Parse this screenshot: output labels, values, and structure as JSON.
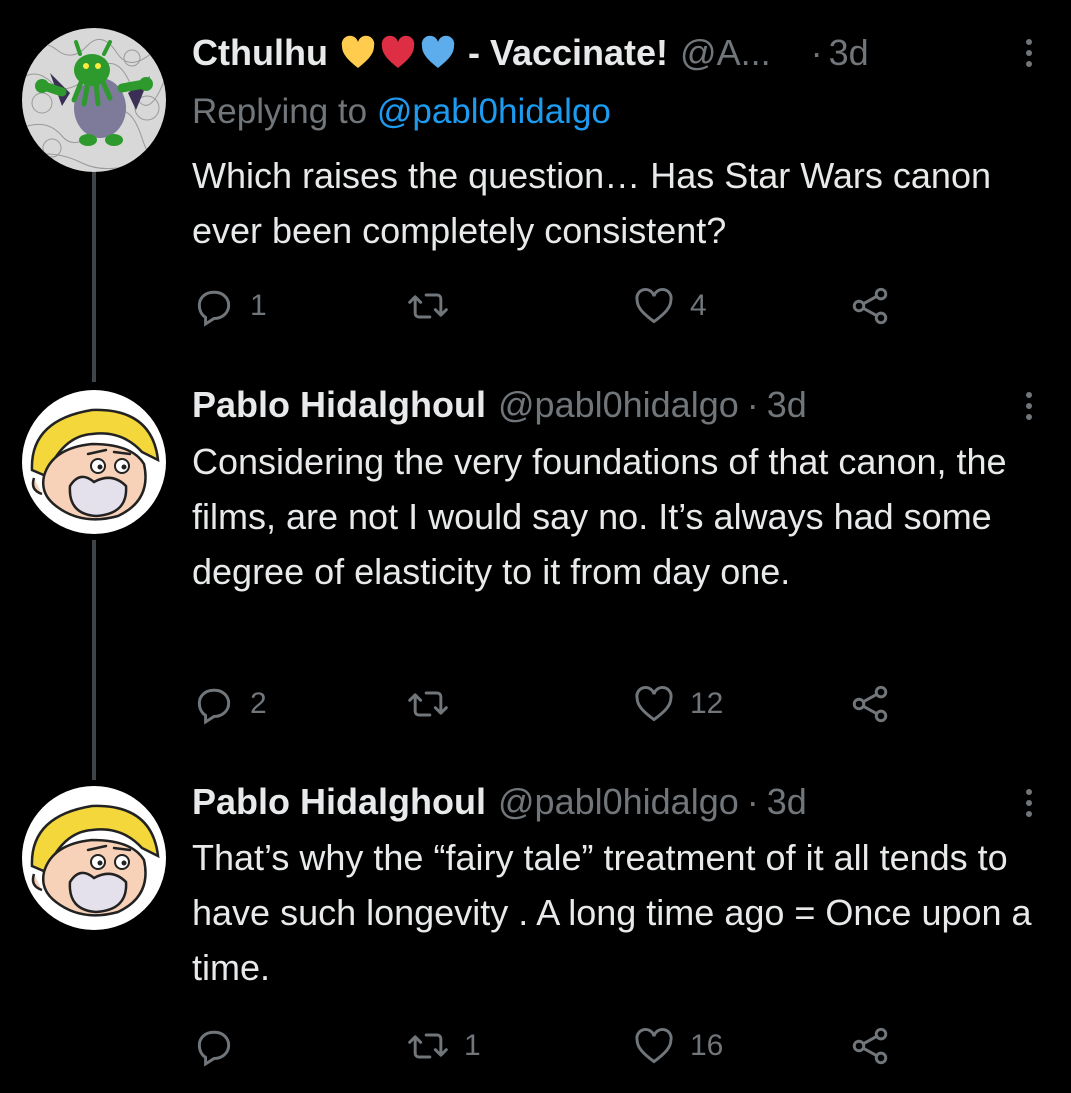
{
  "tweets": [
    {
      "name": "Cthulhu",
      "name_suffix": "- Vaccinate!",
      "emojis": [
        "yellow-heart",
        "red-heart",
        "blue-heart"
      ],
      "handle": "@A...",
      "dot": "·",
      "time": "3d",
      "replying_prefix": "Replying to",
      "replying_to": "@pabl0hidalgo",
      "text": "Which raises the question… Has Star Wars canon ever been completely consistent?",
      "replies": "1",
      "retweets": "",
      "likes": "4"
    },
    {
      "name": "Pablo Hidalghoul",
      "handle": "@pabl0hidalgo",
      "dot": "·",
      "time": "3d",
      "text": "Considering the very foundations of that canon, the films, are not I would say no. It’s always had some degree of elasticity to it from day one.",
      "replies": "2",
      "retweets": "",
      "likes": "12"
    },
    {
      "name": "Pablo Hidalghoul",
      "handle": "@pabl0hidalgo",
      "dot": "·",
      "time": "3d",
      "text": "That’s why the “fairy tale” treatment of it all tends to have such longevity . A long time ago = Once upon a time.",
      "replies": "",
      "retweets": "1",
      "likes": "16"
    }
  ],
  "colors": {
    "background": "#000000",
    "text": "#e7e9ea",
    "muted": "#71767b",
    "link": "#1d9bf0",
    "thread_line": "#3f4448"
  },
  "icons": [
    "reply-icon",
    "retweet-icon",
    "like-icon",
    "share-icon",
    "more-icon"
  ]
}
